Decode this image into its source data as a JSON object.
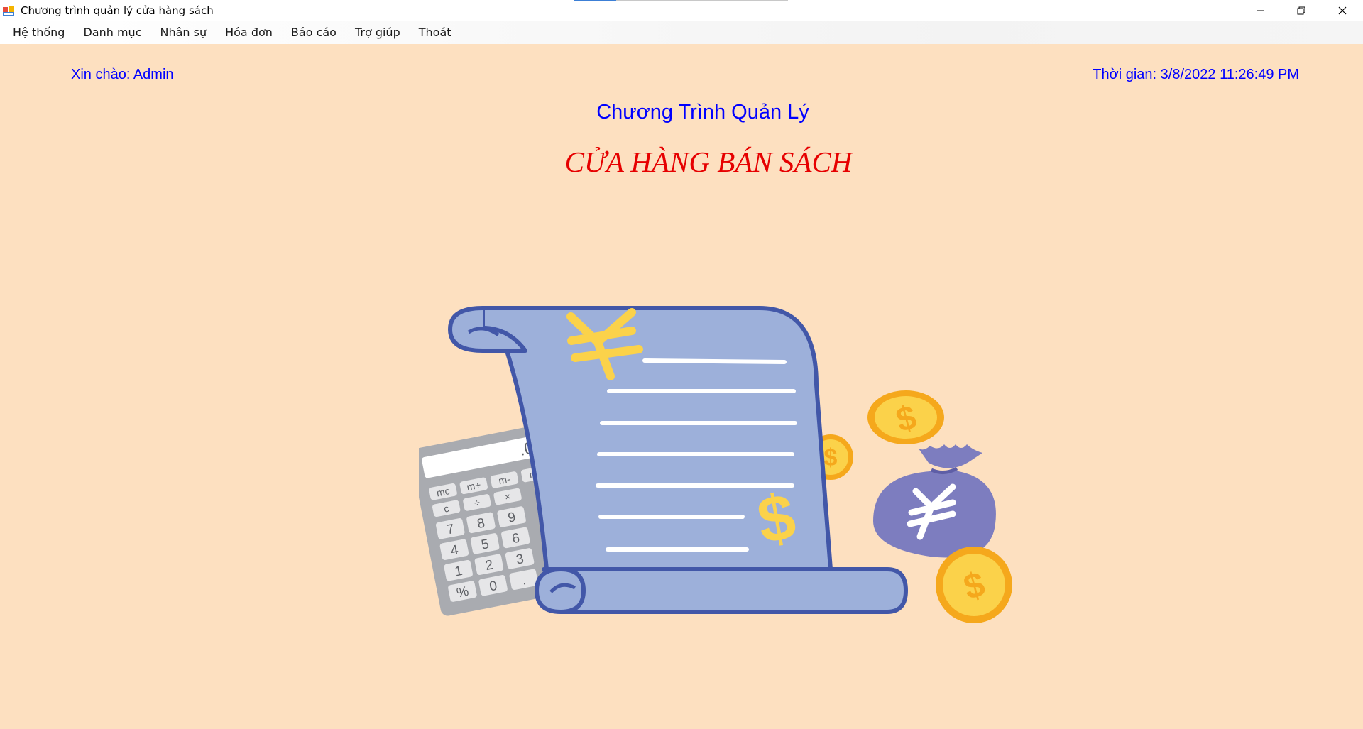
{
  "window": {
    "title": "Chương trình quản lý cửa hàng sách"
  },
  "menu": {
    "items": [
      {
        "label": "Hệ thống"
      },
      {
        "label": "Danh mục"
      },
      {
        "label": "Nhân sự"
      },
      {
        "label": "Hóa đơn"
      },
      {
        "label": "Báo cáo"
      },
      {
        "label": "Trợ giúp"
      },
      {
        "label": "Thoát"
      }
    ]
  },
  "main": {
    "greeting": "Xin chào: Admin",
    "clock": "Thời gian: 3/8/2022 11:26:49 PM",
    "program_title": "Chương Trình Quản Lý",
    "store_title": "CỬA HÀNG BÁN SÁCH",
    "background_color": "#fde0c0",
    "text_blue": "#0000ff",
    "text_red": "#e60000"
  },
  "illustration": {
    "calculator_display": ".0",
    "calculator_keys": [
      "mc",
      "m+",
      "m-",
      "mr",
      "c",
      "÷",
      "×",
      "7",
      "8",
      "9",
      "4",
      "5",
      "6",
      "1",
      "2",
      "3",
      "%",
      "0",
      "."
    ],
    "icons": [
      "receipt-scroll-icon",
      "calculator-icon",
      "yen-symbol-icon",
      "dollar-symbol-icon",
      "coin-icon",
      "money-bag-icon"
    ]
  }
}
